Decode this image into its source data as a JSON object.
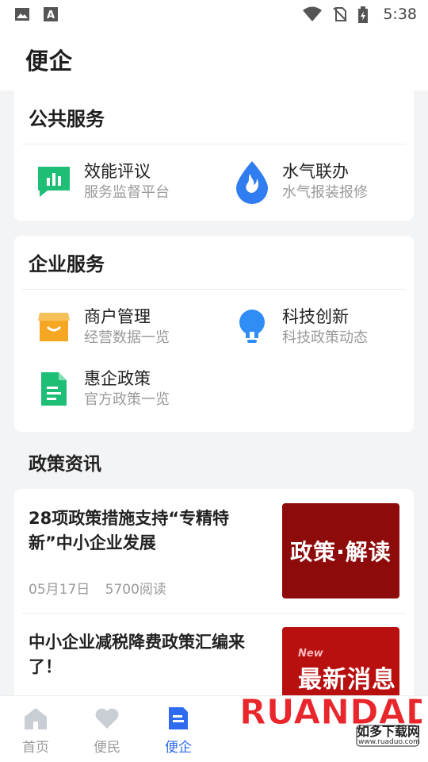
{
  "status_bar": {
    "time": "5:38"
  },
  "header": {
    "title": "便企"
  },
  "public_services": {
    "title": "公共服务",
    "items": [
      {
        "title": "效能评议",
        "subtitle": "服务监督平台",
        "icon": "chart-bubble-icon",
        "color": "#1fbe77"
      },
      {
        "title": "水气联办",
        "subtitle": "水气报装报修",
        "icon": "water-drop-icon",
        "color": "#2f7df0"
      }
    ]
  },
  "enterprise_services": {
    "title": "企业服务",
    "items": [
      {
        "title": "商户管理",
        "subtitle": "经营数据一览",
        "icon": "store-icon",
        "color": "#f5a623"
      },
      {
        "title": "科技创新",
        "subtitle": "科技政策动态",
        "icon": "lightbulb-icon",
        "color": "#2f7df0"
      },
      {
        "title": "惠企政策",
        "subtitle": "官方政策一览",
        "icon": "document-icon",
        "color": "#1fbe77"
      }
    ]
  },
  "policy_news": {
    "title": "政策资讯",
    "items": [
      {
        "title": "28项政策措施支持“专精特新”中小企业发展",
        "date": "05月17日",
        "reads": "5700阅读",
        "thumb_text": "政策·解读"
      },
      {
        "title": "中小企业减税降费政策汇编来了！",
        "thumb_badge": "New",
        "thumb_text": "最新消息"
      }
    ]
  },
  "bottom_nav": {
    "items": [
      {
        "label": "首页",
        "icon": "home-icon",
        "active": false
      },
      {
        "label": "便民",
        "icon": "heart-icon",
        "active": false
      },
      {
        "label": "便企",
        "icon": "document-icon",
        "active": true
      }
    ]
  },
  "watermark": {
    "brand": "RUANDADO",
    "cn": "如多下载网",
    "url": "www.ruaduo.com"
  },
  "colors": {
    "accent": "#2f6bf0",
    "background": "#f3f4f6",
    "thumb_red": "#8e0b0b"
  }
}
